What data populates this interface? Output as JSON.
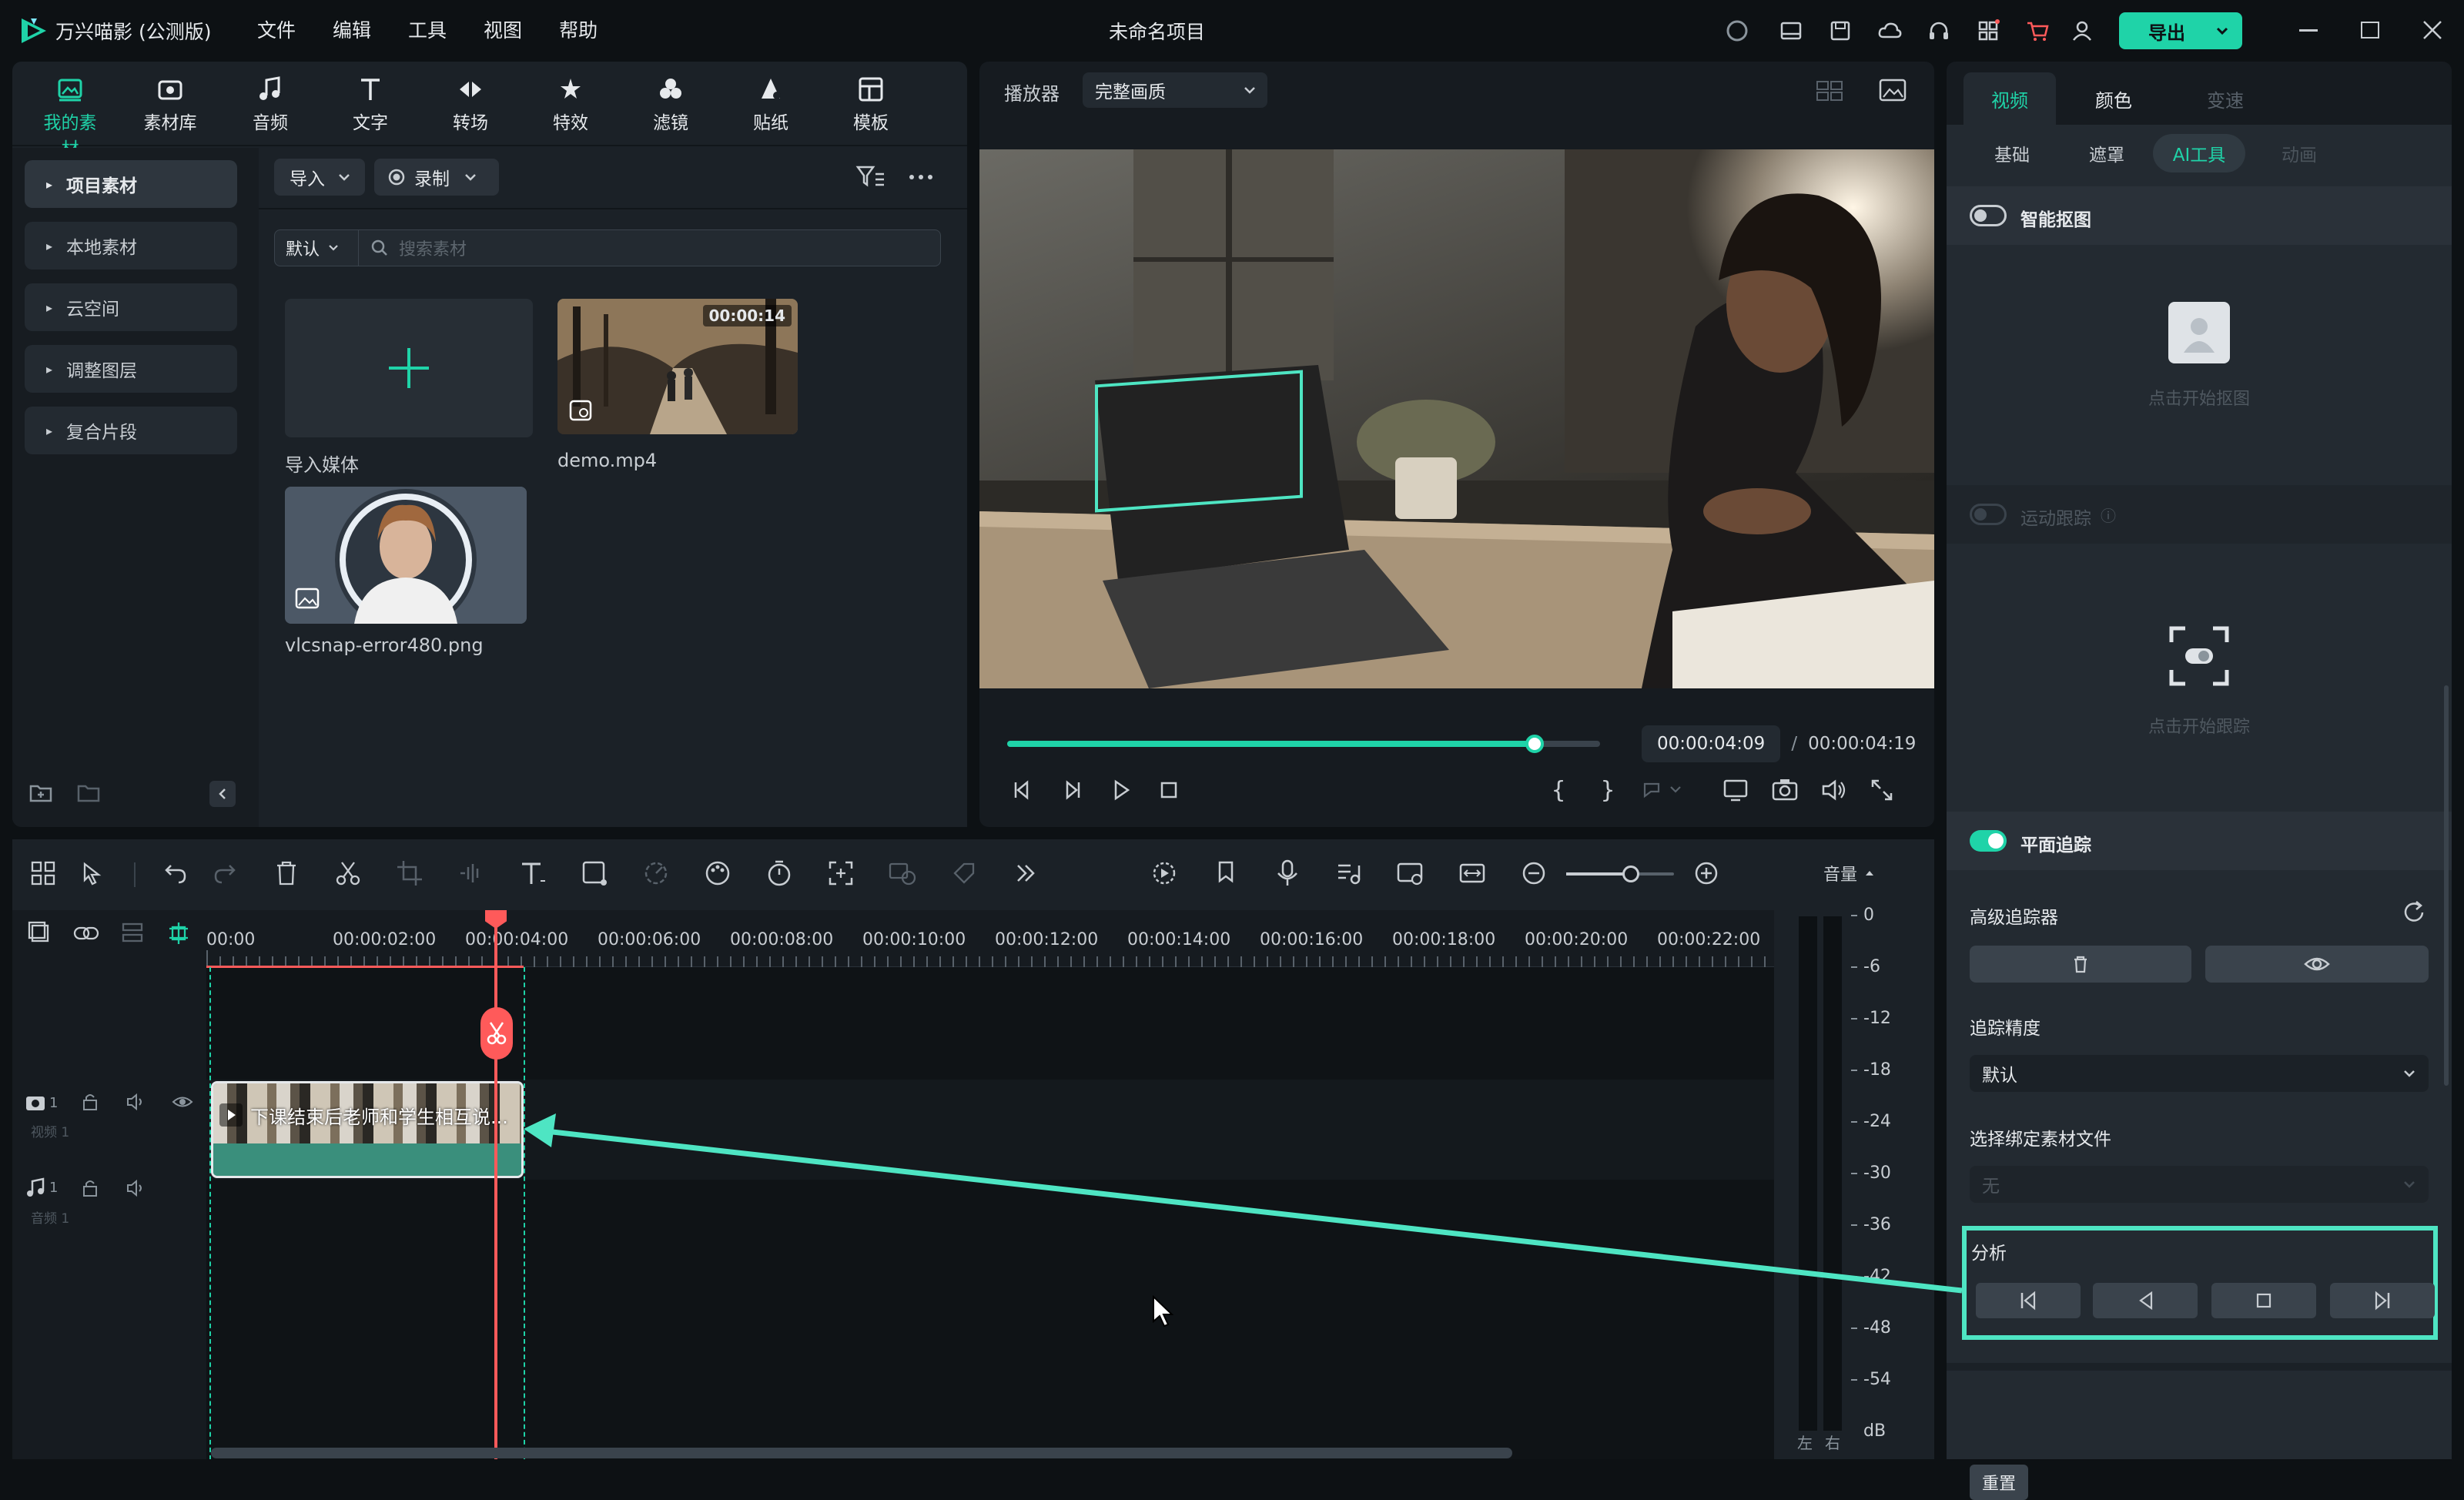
{
  "app": {
    "name": "万兴喵影 (公测版)",
    "menu": [
      "文件",
      "编辑",
      "工具",
      "视图",
      "帮助"
    ],
    "project_title": "未命名项目",
    "export_label": "导出",
    "colors": {
      "accent": "#1fd3a8",
      "bg": "#0d1114",
      "panel": "#1b2127",
      "playhead": "#ff5a5a",
      "highlight": "#4ee5c3"
    }
  },
  "toolbar_tabs": [
    {
      "label": "我的素材",
      "icon": "my-media-icon",
      "active": true
    },
    {
      "label": "素材库",
      "icon": "library-icon"
    },
    {
      "label": "音频",
      "icon": "music-note-icon"
    },
    {
      "label": "文字",
      "icon": "text-icon"
    },
    {
      "label": "转场",
      "icon": "transition-icon"
    },
    {
      "label": "特效",
      "icon": "effects-icon"
    },
    {
      "label": "滤镜",
      "icon": "filter-icon"
    },
    {
      "label": "贴纸",
      "icon": "sticker-icon"
    },
    {
      "label": "模板",
      "icon": "template-icon"
    }
  ],
  "media_sidebar": [
    "项目素材",
    "本地素材",
    "云空间",
    "调整图层",
    "复合片段"
  ],
  "media_panel": {
    "import_label": "导入",
    "record_label": "录制",
    "sort_label": "默认",
    "search_placeholder": "搜索素材",
    "items": [
      {
        "name": "导入媒体"
      },
      {
        "name": "demo.mp4",
        "duration": "00:00:14"
      },
      {
        "name": "vlcsnap-error480.png"
      }
    ]
  },
  "player": {
    "label": "播放器",
    "quality": "完整画质",
    "current_time": "00:00:04:09",
    "separator": "/",
    "total_time": "00:00:04:19",
    "progress": 0.89
  },
  "right_panel": {
    "tabs": [
      "视频",
      "颜色",
      "变速"
    ],
    "subtabs": [
      "基础",
      "遮罩",
      "AI工具",
      "动画"
    ],
    "smart_cutout": {
      "label": "智能抠图",
      "hint": "点击开始抠图",
      "enabled": false
    },
    "motion_tracking": {
      "label": "运动跟踪",
      "hint": "点击开始跟踪",
      "enabled": false
    },
    "planar_tracking": {
      "label": "平面追踪",
      "enabled": true,
      "advanced_tracker": "高级追踪器",
      "precision_label": "追踪精度",
      "precision_value": "默认",
      "bind_label": "选择绑定素材文件",
      "bind_value": "无",
      "analysis_label": "分析"
    },
    "reset_label": "重置"
  },
  "timeline": {
    "ruler": [
      "00:00",
      "00:00:02:00",
      "00:00:04:00",
      "00:00:06:00",
      "00:00:08:00",
      "00:00:10:00",
      "00:00:12:00",
      "00:00:14:00",
      "00:00:16:00",
      "00:00:18:00",
      "00:00:20:00",
      "00:00:22:00"
    ],
    "clip_title": "下课结束后老师和学生相互说...",
    "video_track": {
      "index": "1",
      "label": "视频 1"
    },
    "audio_track": {
      "index": "1",
      "label": "音频 1"
    },
    "zoom": 0.6
  },
  "volume_meter": {
    "label": "音量",
    "ticks": [
      "0",
      "-6",
      "-12",
      "-18",
      "-24",
      "-30",
      "-36",
      "-42",
      "-48",
      "-54"
    ],
    "unit": "dB",
    "left": "左",
    "right": "右"
  }
}
